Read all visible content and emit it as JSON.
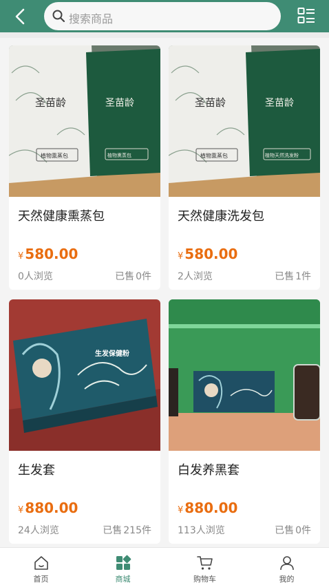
{
  "header": {
    "search_placeholder": "搜索商品",
    "back_icon": "chevron-left-icon",
    "menu_icon": "list-layout-icon"
  },
  "products": [
    {
      "title": "天然健康熏蒸包",
      "currency": "¥",
      "price": "580.00",
      "views": "0人浏览",
      "sold_label": "已售",
      "sold": "0件"
    },
    {
      "title": "天然健康洗发包",
      "currency": "¥",
      "price": "580.00",
      "views": "2人浏览",
      "sold_label": "已售",
      "sold": "1件"
    },
    {
      "title": "生发套",
      "currency": "¥",
      "price": "880.00",
      "views": "24人浏览",
      "sold_label": "已售",
      "sold": "215件"
    },
    {
      "title": "白发养黑套",
      "currency": "¥",
      "price": "880.00",
      "views": "113人浏览",
      "sold_label": "已售",
      "sold": "0件"
    }
  ],
  "product_images": {
    "pouch_brand": "圣苗龄",
    "pouch_left_label": "植物熏蒸包",
    "pouch_right_label_1": "植物熏蒸包",
    "pouch_right_label_2": "植物天然洗发粉",
    "box_label": "生发保健粉"
  },
  "tabbar": {
    "items": [
      {
        "label": "首页",
        "icon": "home-icon",
        "active": false
      },
      {
        "label": "商城",
        "icon": "mall-grid-icon",
        "active": true
      },
      {
        "label": "购物车",
        "icon": "cart-icon",
        "active": false
      },
      {
        "label": "我的",
        "icon": "user-icon",
        "active": false
      }
    ]
  },
  "colors": {
    "header_bg": "#3f8c74",
    "price": "#e96d10",
    "active_tab": "#3f8c74"
  }
}
